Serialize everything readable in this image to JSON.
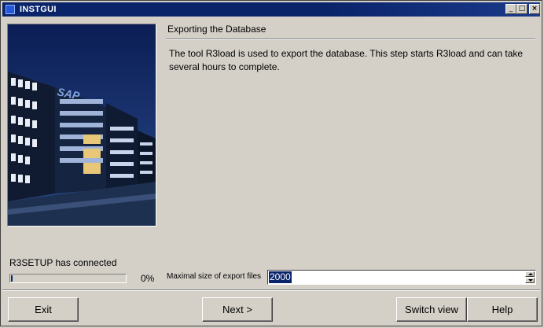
{
  "window": {
    "title": "INSTGUI",
    "minimize_glyph": "_",
    "maximize_glyph": "□",
    "close_glyph": "×"
  },
  "step": {
    "heading": "Exporting the Database",
    "description": "The tool R3load is used to export the database. This step starts R3load and can take several hours to complete."
  },
  "status": {
    "text": "R3SETUP has connected",
    "progress_percent": 0,
    "progress_label": "0%"
  },
  "export_size": {
    "label": "Maximal size of export files",
    "value": "2000"
  },
  "buttons": {
    "exit": "Exit",
    "next": "Next >",
    "switch_view": "Switch view",
    "help": "Help"
  },
  "photo": {
    "logo": "SAP"
  },
  "colors": {
    "titlebar": "#0a246a",
    "face": "#d4d0c8",
    "selection": "#0a246a"
  }
}
